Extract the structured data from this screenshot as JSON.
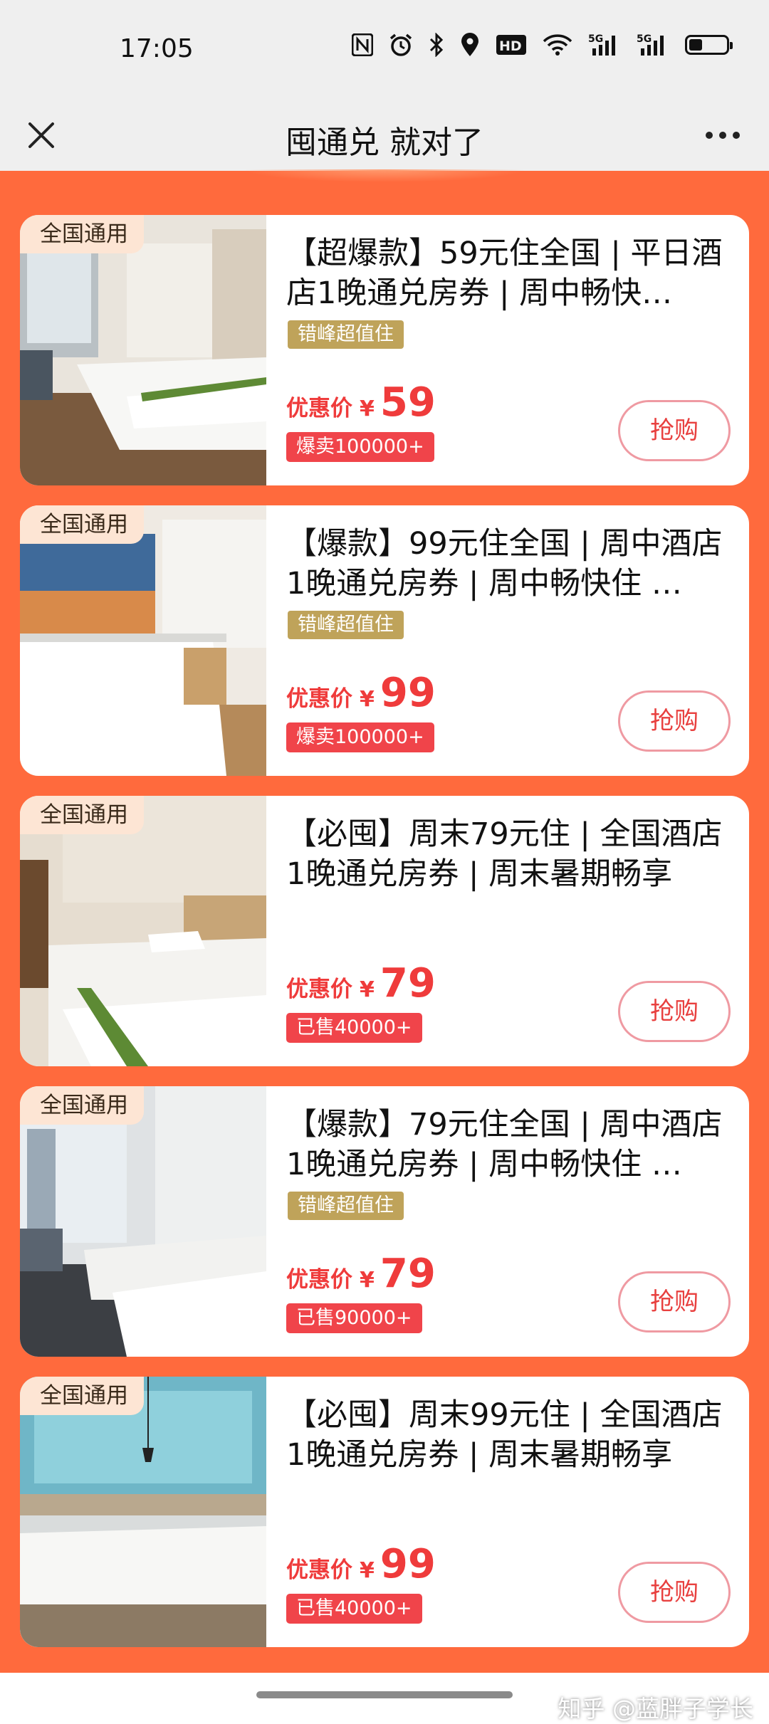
{
  "status_bar": {
    "time": "17:05",
    "icons": [
      "nfc-icon",
      "alarm-icon",
      "bluetooth-icon",
      "location-icon",
      "hd-icon",
      "wifi-icon",
      "signal-5g-icon",
      "signal-5g-icon",
      "battery-icon"
    ],
    "hd_label": "HD",
    "net_label_1": "5G",
    "net_label_2": "5G",
    "battery_level": 0.35
  },
  "nav": {
    "title": "囤通兑 就对了",
    "close_icon": "close-icon",
    "more_icon": "more-dots-icon"
  },
  "colors": {
    "page_bg": "#ff6a3d",
    "price_red": "#ef3b3b",
    "gold_tag": "#bfa35a",
    "sold_red": "#f0444a"
  },
  "products": [
    {
      "badge": "全国通用",
      "title": "【超爆款】59元住全国 | 平日酒店1晚通兑房券 | 周中畅快…",
      "tag": "错峰超值住",
      "price_label": "优惠价",
      "currency": "¥",
      "price": "59",
      "sold": "爆卖100000+",
      "button": "抢购"
    },
    {
      "badge": "全国通用",
      "title": "【爆款】99元住全国 | 周中酒店1晚通兑房券 | 周中畅快住 …",
      "tag": "错峰超值住",
      "price_label": "优惠价",
      "currency": "¥",
      "price": "99",
      "sold": "爆卖100000+",
      "button": "抢购"
    },
    {
      "badge": "全国通用",
      "title": "【必囤】周末79元住 | 全国酒店1晚通兑房券 | 周末暑期畅享",
      "tag": "",
      "price_label": "优惠价",
      "currency": "¥",
      "price": "79",
      "sold": "已售40000+",
      "button": "抢购"
    },
    {
      "badge": "全国通用",
      "title": "【爆款】79元住全国 | 周中酒店1晚通兑房券 | 周中畅快住 …",
      "tag": "错峰超值住",
      "price_label": "优惠价",
      "currency": "¥",
      "price": "79",
      "sold": "已售90000+",
      "button": "抢购"
    },
    {
      "badge": "全国通用",
      "title": "【必囤】周末99元住 | 全国酒店1晚通兑房券 | 周末暑期畅享",
      "tag": "",
      "price_label": "优惠价",
      "currency": "¥",
      "price": "99",
      "sold": "已售40000+",
      "button": "抢购"
    }
  ],
  "watermark": "知乎 @蓝胖子学长"
}
